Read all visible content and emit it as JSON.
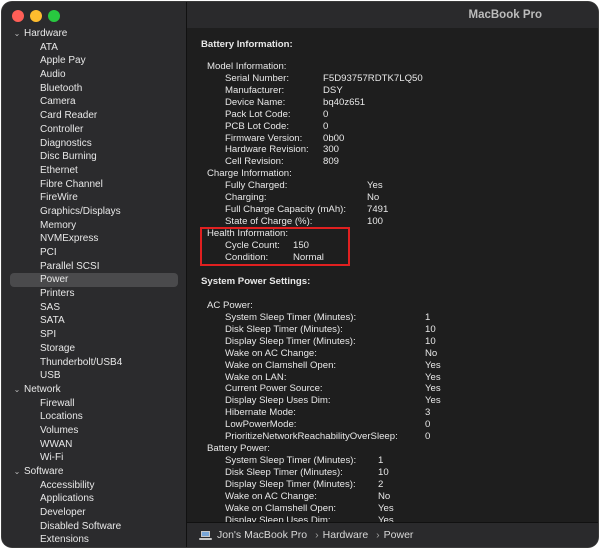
{
  "window": {
    "title": "MacBook Pro"
  },
  "sidebar": {
    "categories": [
      {
        "label": "Hardware",
        "items": [
          "ATA",
          "Apple Pay",
          "Audio",
          "Bluetooth",
          "Camera",
          "Card Reader",
          "Controller",
          "Diagnostics",
          "Disc Burning",
          "Ethernet",
          "Fibre Channel",
          "FireWire",
          "Graphics/Displays",
          "Memory",
          "NVMExpress",
          "PCI",
          "Parallel SCSI",
          "Power",
          "Printers",
          "SAS",
          "SATA",
          "SPI",
          "Storage",
          "Thunderbolt/USB4",
          "USB"
        ]
      },
      {
        "label": "Network",
        "items": [
          "Firewall",
          "Locations",
          "Volumes",
          "WWAN",
          "Wi-Fi"
        ]
      },
      {
        "label": "Software",
        "items": [
          "Accessibility",
          "Applications",
          "Developer",
          "Disabled Software",
          "Extensions"
        ]
      }
    ],
    "selected": "Power"
  },
  "content": {
    "battery_title": "Battery Information:",
    "model_header": "Model Information:",
    "model": [
      {
        "k": "Serial Number:",
        "v": "F5D93757RDTK7LQ50"
      },
      {
        "k": "Manufacturer:",
        "v": "DSY"
      },
      {
        "k": "Device Name:",
        "v": "bq40z651"
      },
      {
        "k": "Pack Lot Code:",
        "v": "0"
      },
      {
        "k": "PCB Lot Code:",
        "v": "0"
      },
      {
        "k": "Firmware Version:",
        "v": "0b00"
      },
      {
        "k": "Hardware Revision:",
        "v": "300"
      },
      {
        "k": "Cell Revision:",
        "v": "809"
      }
    ],
    "charge_header": "Charge Information:",
    "charge": [
      {
        "k": "Fully Charged:",
        "v": "Yes"
      },
      {
        "k": "Charging:",
        "v": "No"
      },
      {
        "k": "Full Charge Capacity (mAh):",
        "v": "7491"
      },
      {
        "k": "State of Charge (%):",
        "v": "100"
      }
    ],
    "health_header": "Health Information:",
    "health": [
      {
        "k": "Cycle Count:",
        "v": "150"
      },
      {
        "k": "Condition:",
        "v": "Normal"
      }
    ],
    "power_title": "System Power Settings:",
    "ac_header": "AC Power:",
    "ac": [
      {
        "k": "System Sleep Timer (Minutes):",
        "v": "1"
      },
      {
        "k": "Disk Sleep Timer (Minutes):",
        "v": "10"
      },
      {
        "k": "Display Sleep Timer (Minutes):",
        "v": "10"
      },
      {
        "k": "Wake on AC Change:",
        "v": "No"
      },
      {
        "k": "Wake on Clamshell Open:",
        "v": "Yes"
      },
      {
        "k": "Wake on LAN:",
        "v": "Yes"
      },
      {
        "k": "Current Power Source:",
        "v": "Yes"
      },
      {
        "k": "Display Sleep Uses Dim:",
        "v": "Yes"
      },
      {
        "k": "Hibernate Mode:",
        "v": "3"
      },
      {
        "k": "LowPowerMode:",
        "v": "0"
      },
      {
        "k": "PrioritizeNetworkReachabilityOverSleep:",
        "v": "0"
      }
    ],
    "battery_power_header": "Battery Power:",
    "battery_power": [
      {
        "k": "System Sleep Timer (Minutes):",
        "v": "1"
      },
      {
        "k": "Disk Sleep Timer (Minutes):",
        "v": "10"
      },
      {
        "k": "Display Sleep Timer (Minutes):",
        "v": "2"
      },
      {
        "k": "Wake on AC Change:",
        "v": "No"
      },
      {
        "k": "Wake on Clamshell Open:",
        "v": "Yes"
      },
      {
        "k": "Display Sleep Uses Dim:",
        "v": "Yes"
      }
    ]
  },
  "pathbar": {
    "items": [
      "Jon's MacBook Pro",
      "Hardware",
      "Power"
    ],
    "separator": "›",
    "icon": "laptop-icon"
  },
  "colors": {
    "highlight_box": "#e02020",
    "selected_row": "#4a4a4c"
  }
}
